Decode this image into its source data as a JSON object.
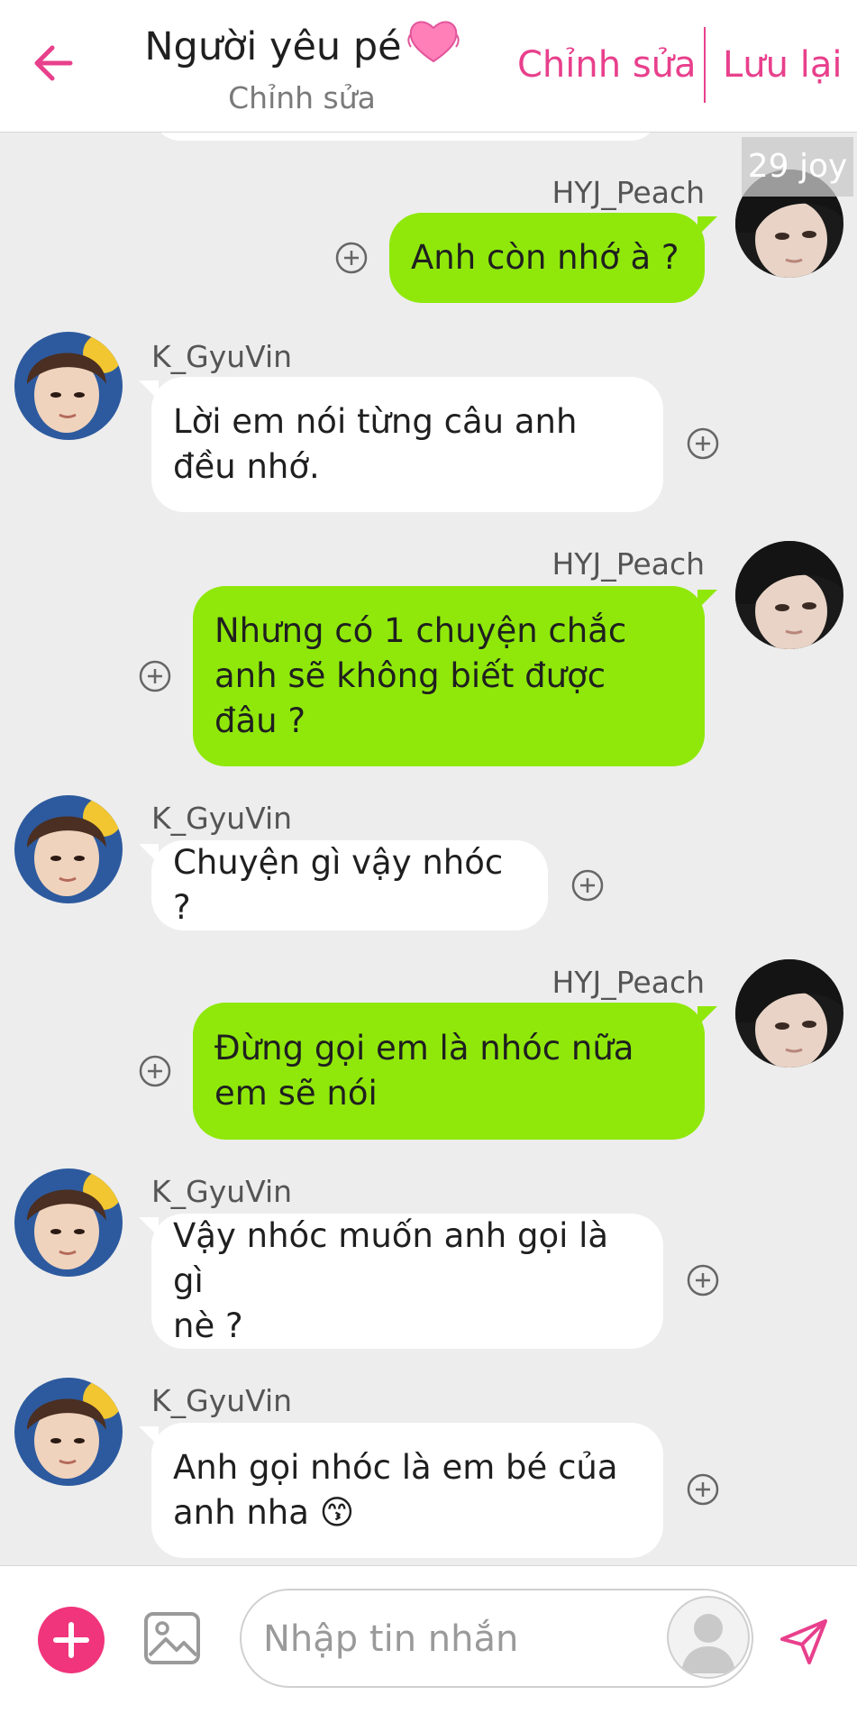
{
  "header": {
    "title": "Người yêu pé",
    "subtitle": "Chỉnh sửa",
    "edit_label": "Chỉnh sửa",
    "save_label": "Lưu lại",
    "accent_color": "#e8408c"
  },
  "watermark": "29 joy",
  "messages": [
    {
      "sender": "HYJ_Peach",
      "side": "right",
      "text": "Anh còn nhớ à ?"
    },
    {
      "sender": "K_GyuVin",
      "side": "left",
      "text": "Lời em nói từng câu anh\nđều nhớ."
    },
    {
      "sender": "HYJ_Peach",
      "side": "right",
      "text": "Nhưng có 1 chuyện chắc\nanh sẽ không biết được\nđâu ?"
    },
    {
      "sender": "K_GyuVin",
      "side": "left",
      "text": "Chuyện gì vậy nhóc ?"
    },
    {
      "sender": "HYJ_Peach",
      "side": "right",
      "text": "Đừng gọi em là nhóc nữa\nem sẽ nói"
    },
    {
      "sender": "K_GyuVin",
      "side": "left",
      "text": "Vậy nhóc muốn anh gọi là gì\nnè ?"
    },
    {
      "sender": "K_GyuVin",
      "side": "left",
      "text": "Anh gọi nhóc là em bé của\nanh nha 😙"
    }
  ],
  "composer": {
    "placeholder": "Nhập tin nhắn",
    "add_icon": "plus-circle-icon",
    "image_icon": "image-icon",
    "send_icon": "send-icon"
  },
  "colors": {
    "outgoing_bubble": "#8fe80a",
    "incoming_bubble": "#ffffff",
    "background": "#ededed",
    "add_button": "#f0357c"
  }
}
